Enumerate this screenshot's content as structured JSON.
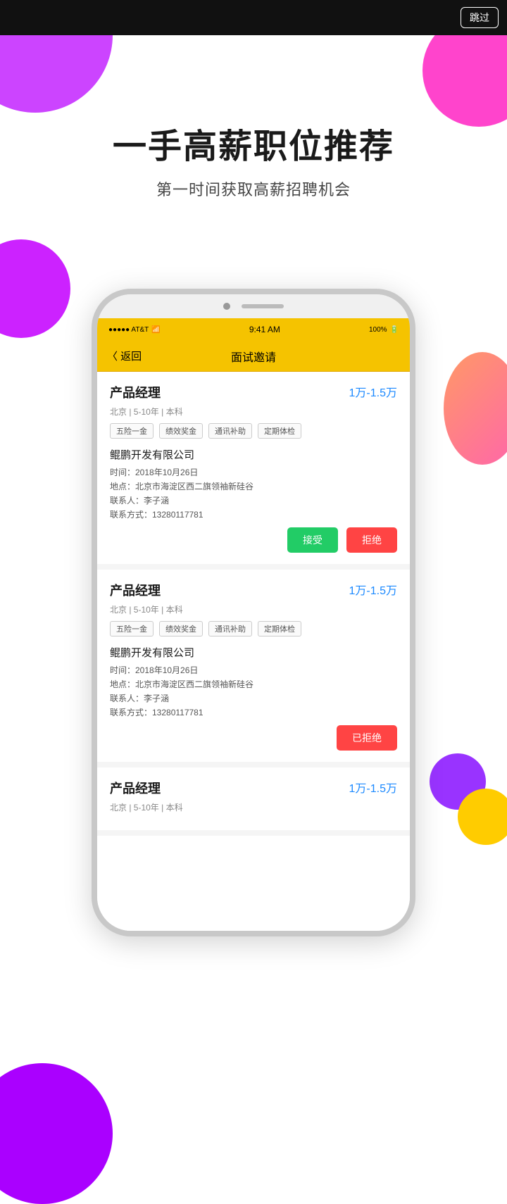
{
  "topBar": {
    "skipLabel": "跳过"
  },
  "headline": {
    "title": "一手高薪职位推荐",
    "subtitle": "第一时间获取高薪招聘机会"
  },
  "phone": {
    "statusBar": {
      "carrier": "●●●●● AT&T",
      "wifi": "▾",
      "time": "9:41 AM",
      "battery": "100%"
    },
    "navBar": {
      "backLabel": "〈 返回",
      "title": "面试邀请"
    },
    "cards": [
      {
        "title": "产品经理",
        "salary": "1万-1.5万",
        "meta": "北京 | 5-10年 | 本科",
        "tags": [
          "五险一金",
          "绩效奖金",
          "通讯补助",
          "定期体检"
        ],
        "company": "鲲鹏开发有限公司",
        "time": "时间：2018年10月26日",
        "location": "地点：北京市海淀区西二旗领袖新硅谷",
        "contact": "联系人：李子涵",
        "phone": "联系方式：13280117781",
        "actions": "accept_reject"
      },
      {
        "title": "产品经理",
        "salary": "1万-1.5万",
        "meta": "北京 | 5-10年 | 本科",
        "tags": [
          "五险一金",
          "绩效奖金",
          "通讯补助",
          "定期体检"
        ],
        "company": "鲲鹏开发有限公司",
        "time": "时间：2018年10月26日",
        "location": "地点：北京市海淀区西二旗领袖新硅谷",
        "contact": "联系人：李子涵",
        "phone": "联系方式：13280117781",
        "actions": "rejected"
      },
      {
        "title": "产品经理",
        "salary": "1万-1.5万",
        "meta": "北京 | 5-10年 | 本科",
        "tags": [],
        "company": "",
        "time": "",
        "location": "",
        "contact": "",
        "phone": "",
        "actions": "none"
      }
    ],
    "buttons": {
      "accept": "接受",
      "reject": "拒绝",
      "rejected": "已拒绝"
    }
  }
}
